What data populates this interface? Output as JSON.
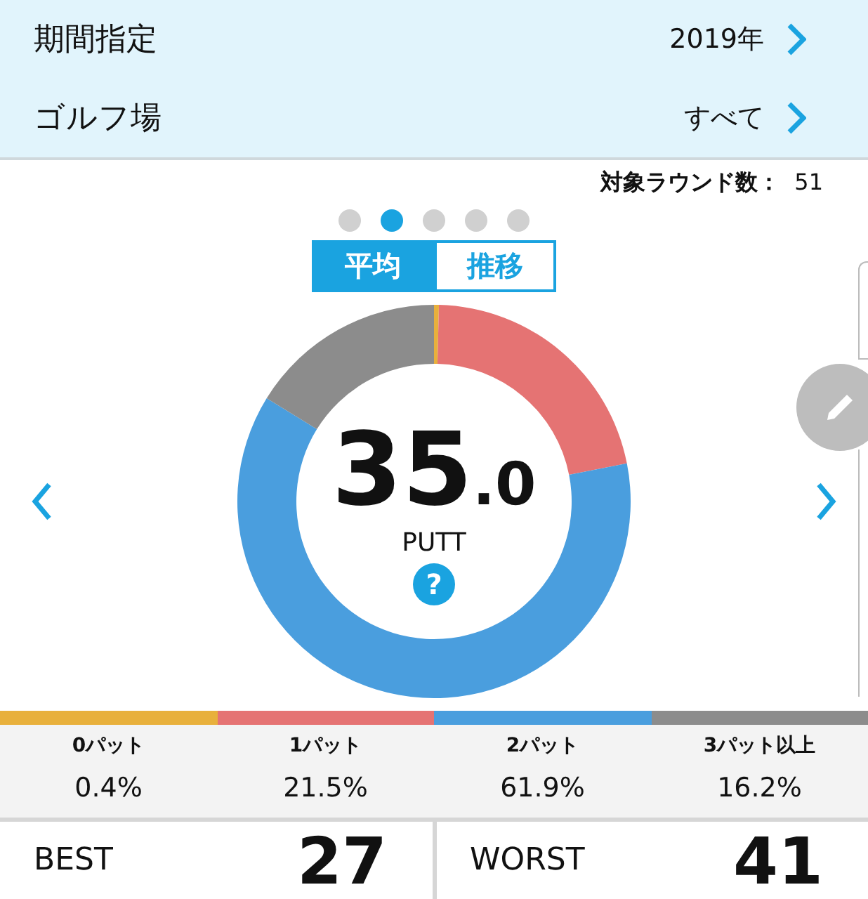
{
  "filters": [
    {
      "label": "期間指定",
      "value": "2019年"
    },
    {
      "label": "ゴルフ場",
      "value": "すべて"
    }
  ],
  "round_count": {
    "label": "対象ラウンド数：",
    "value": "51"
  },
  "pager_dots": [
    {
      "selected": false
    },
    {
      "selected": true
    },
    {
      "selected": false
    },
    {
      "selected": false
    },
    {
      "selected": false
    }
  ],
  "view_tabs": [
    {
      "label": "平均",
      "selected": true
    },
    {
      "label": "推移",
      "selected": false
    }
  ],
  "summary": {
    "value_int": "35",
    "value_dec": ".0",
    "unit": "PUTT",
    "help": "?"
  },
  "chart_data": {
    "type": "donut",
    "categories": [
      "0パット",
      "1パット",
      "2パット",
      "3パット以上"
    ],
    "values": [
      0.4,
      21.5,
      61.9,
      16.2
    ]
  },
  "legend": [
    {
      "value": "0.4%",
      "color": "#e8b03c"
    },
    {
      "value": "21.5%",
      "color": "#e57373"
    },
    {
      "value": "61.9%",
      "color": "#4a9ede"
    },
    {
      "value": "16.2%",
      "color": "#8c8c8c"
    }
  ],
  "records": [
    {
      "label": "BEST",
      "value": "27"
    },
    {
      "label": "WORST",
      "value": "41"
    }
  ]
}
